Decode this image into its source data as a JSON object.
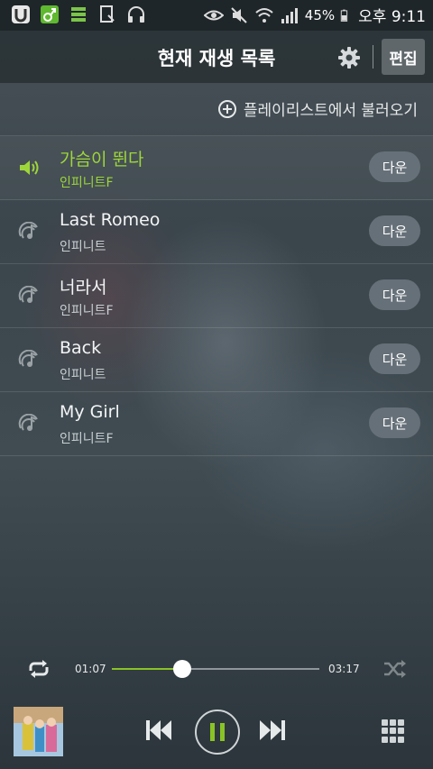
{
  "status_bar": {
    "battery": "45%",
    "time": "오후 9:11",
    "left_icons": [
      "u-app-icon",
      "music-note-icon",
      "list-app-icon",
      "download-icon",
      "headphones-icon"
    ],
    "right_icons": [
      "eye-icon",
      "mute-icon",
      "wifi-icon",
      "signal-icon",
      "battery-icon"
    ]
  },
  "header": {
    "title": "현재 재생 목록",
    "edit_label": "편집"
  },
  "load_playlist_label": "플레이리스트에서 불러오기",
  "tracks": [
    {
      "title": "가슴이 뛴다",
      "artist": "인피니트F",
      "download_label": "다운",
      "playing": true
    },
    {
      "title": "Last Romeo",
      "artist": "인피니트",
      "download_label": "다운",
      "playing": false
    },
    {
      "title": "너라서",
      "artist": "인피니트F",
      "download_label": "다운",
      "playing": false
    },
    {
      "title": "Back",
      "artist": "인피니트",
      "download_label": "다운",
      "playing": false
    },
    {
      "title": "My Girl",
      "artist": "인피니트F",
      "download_label": "다운",
      "playing": false
    }
  ],
  "player": {
    "current_time": "01:07",
    "total_time": "03:17",
    "progress": 0.34
  },
  "colors": {
    "accent": "#8ac326",
    "playing_text": "#9ed63a",
    "download_button": "#667078"
  }
}
